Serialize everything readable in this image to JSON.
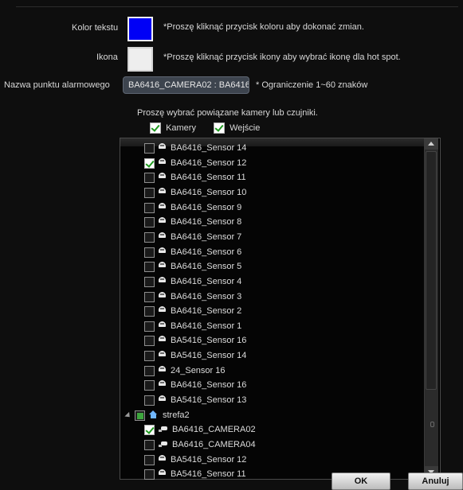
{
  "form": {
    "text_color_label": "Kolor tekstu",
    "text_color_hint": "*Proszę kliknąć przycisk koloru aby dokonać zmian.",
    "text_color_value": "#0000f6",
    "icon_label": "Ikona",
    "icon_hint": "*Proszę kliknąć przycisk ikony aby wybrać ikonę dla hot spot.",
    "alarm_name_label": "Nazwa punktu alarmowego",
    "alarm_name_value": "BA6416_CAMERA02 : BA6416",
    "alarm_name_hint": "* Ograniczenie 1~60 znaków",
    "select_prompt": "Proszę wybrać powiązane kamery lub czujniki.",
    "filter_cameras": "Kamery",
    "filter_inputs": "Wejście"
  },
  "tree": {
    "items": [
      {
        "label": "BA6416_Sensor 14",
        "icon": "sensor-icon",
        "checked": false
      },
      {
        "label": "BA6416_Sensor 12",
        "icon": "sensor-icon",
        "checked": true
      },
      {
        "label": "BA6416_Sensor 11",
        "icon": "sensor-icon",
        "checked": false
      },
      {
        "label": "BA6416_Sensor 10",
        "icon": "sensor-icon",
        "checked": false
      },
      {
        "label": "BA6416_Sensor 9",
        "icon": "sensor-icon",
        "checked": false
      },
      {
        "label": "BA6416_Sensor 8",
        "icon": "sensor-icon",
        "checked": false
      },
      {
        "label": "BA6416_Sensor 7",
        "icon": "sensor-icon",
        "checked": false
      },
      {
        "label": "BA6416_Sensor 6",
        "icon": "sensor-icon",
        "checked": false
      },
      {
        "label": "BA6416_Sensor 5",
        "icon": "sensor-icon",
        "checked": false
      },
      {
        "label": "BA6416_Sensor 4",
        "icon": "sensor-icon",
        "checked": false
      },
      {
        "label": "BA6416_Sensor 3",
        "icon": "sensor-icon",
        "checked": false
      },
      {
        "label": "BA6416_Sensor 2",
        "icon": "sensor-icon",
        "checked": false
      },
      {
        "label": "BA6416_Sensor 1",
        "icon": "sensor-icon",
        "checked": false
      },
      {
        "label": "BA5416_Sensor 16",
        "icon": "sensor-icon",
        "checked": false
      },
      {
        "label": "BA5416_Sensor 14",
        "icon": "sensor-icon",
        "checked": false
      },
      {
        "label": "24_Sensor 16",
        "icon": "sensor-icon",
        "checked": false
      },
      {
        "label": "BA6416_Sensor 16",
        "icon": "sensor-icon",
        "checked": false
      },
      {
        "label": "BA5416_Sensor 13",
        "icon": "sensor-icon",
        "checked": false
      },
      {
        "label": "strefa2",
        "icon": "house-icon",
        "checked": "partial",
        "group": true
      },
      {
        "label": "BA6416_CAMERA02",
        "icon": "camera-icon",
        "checked": true
      },
      {
        "label": "BA6416_CAMERA04",
        "icon": "camera-icon",
        "checked": false
      },
      {
        "label": "BA5416_Sensor 12",
        "icon": "sensor-icon",
        "checked": false
      },
      {
        "label": "BA5416_Sensor 11",
        "icon": "sensor-icon",
        "checked": false
      }
    ]
  },
  "buttons": {
    "ok": "OK",
    "cancel": "Anuluj"
  }
}
